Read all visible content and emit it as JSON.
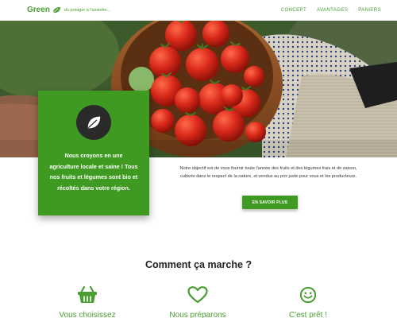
{
  "navbar": {
    "brand_name": "Green",
    "brand_tagline": "du potager à l'assiette...",
    "links": [
      "CONCEPT",
      "AVANTAGES",
      "PANIERS"
    ]
  },
  "card": {
    "text": "Nous croyons en une agriculture locale et saine ! Tous nos fruits et légumes sont bio et récoltés dans votre région."
  },
  "intro": {
    "text": "Notre objectif est de vous fournir toute l'année des fruits et des légumes frais et de saison, cultivés dans le respect de la nature, et vendus au prix juste pour vous et les producteurs.",
    "cta_label": "EN SAVOIR PLUS"
  },
  "how": {
    "title": "Comment ça marche ?",
    "steps": [
      {
        "label": "Vous choisissez",
        "icon": "basket-icon"
      },
      {
        "label": "Nous préparons",
        "icon": "heart-icon"
      },
      {
        "label": "C'est prêt !",
        "icon": "smiley-icon"
      }
    ]
  },
  "colors": {
    "accent": "#3f9a22",
    "brand_text": "#4a9e34"
  }
}
